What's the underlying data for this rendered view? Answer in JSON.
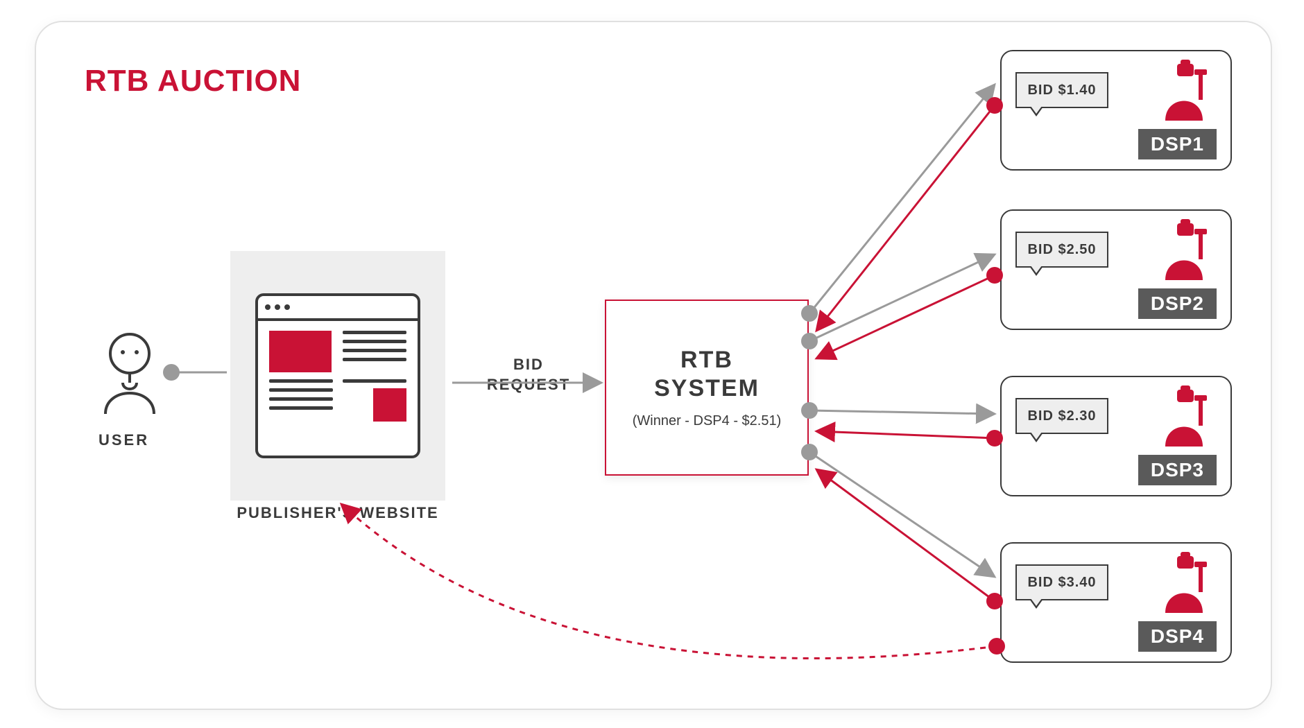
{
  "title": "RTB AUCTION",
  "user_label": "USER",
  "publisher_label": "PUBLISHER'S WEBSITE",
  "bid_request_label_1": "BID",
  "bid_request_label_2": "REQUEST",
  "rtb_title_1": "RTB",
  "rtb_title_2": "SYSTEM",
  "rtb_sub": "(Winner - DSP4 - $2.51)",
  "dsps": [
    {
      "bid": "BID $1.40",
      "label": "DSP1"
    },
    {
      "bid": "BID $2.50",
      "label": "DSP2"
    },
    {
      "bid": "BID $2.30",
      "label": "DSP3"
    },
    {
      "bid": "BID $3.40",
      "label": "DSP4"
    }
  ],
  "colors": {
    "accent": "#C91235",
    "grey": "#9a9a9a"
  }
}
